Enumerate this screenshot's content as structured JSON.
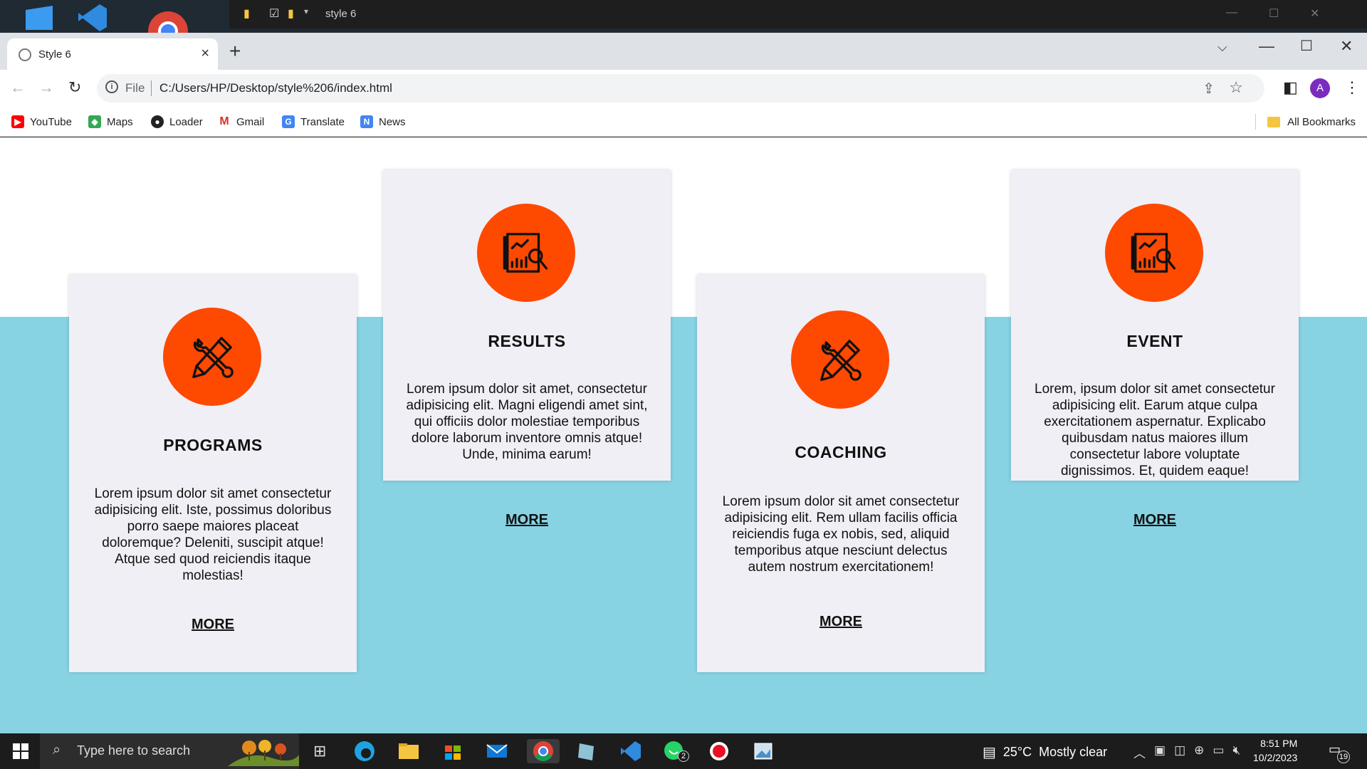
{
  "explorer_window": {
    "title": "style 6"
  },
  "browser": {
    "tab": {
      "title": "Style 6"
    },
    "address": {
      "scheme": "File",
      "url": "C:/Users/HP/Desktop/style%206/index.html"
    },
    "profile_initial": "A",
    "bookmarks": [
      {
        "label": "YouTube",
        "icon": "youtube-icon",
        "color": "#ff0000"
      },
      {
        "label": "Maps",
        "icon": "maps-icon",
        "color": "#34a853"
      },
      {
        "label": "Loader",
        "icon": "loader-icon",
        "color": "#222222"
      },
      {
        "label": "Gmail",
        "icon": "gmail-icon",
        "color": "#d93025"
      },
      {
        "label": "Translate",
        "icon": "translate-icon",
        "color": "#4285f4"
      },
      {
        "label": "News",
        "icon": "news-icon",
        "color": "#4285f4"
      }
    ],
    "all_bookmarks": "All Bookmarks"
  },
  "page": {
    "colors": {
      "accent": "#fe4901",
      "band": "#87d3e3",
      "card": "#f0eff5"
    },
    "cards": [
      {
        "title": "PROGRAMS",
        "icon": "tools-icon",
        "text": "Lorem ipsum dolor sit amet consectetur adipisicing elit. Iste, possimus doloribus porro saepe maiores placeat doloremque? Deleniti, suscipit atque! Atque sed quod reiciendis itaque molestias!",
        "link": "MORE"
      },
      {
        "title": "RESULTS",
        "icon": "report-analytics-icon",
        "text": "Lorem ipsum dolor sit amet, consectetur adipisicing elit. Magni eligendi amet sint, qui officiis dolor molestiae temporibus dolore laborum inventore omnis atque! Unde, minima earum!",
        "link": "MORE"
      },
      {
        "title": "COACHING",
        "icon": "tools-icon",
        "text": "Lorem ipsum dolor sit amet consectetur adipisicing elit. Rem ullam facilis officia reiciendis fuga ex nobis, sed, aliquid temporibus atque nesciunt delectus autem nostrum exercitationem!",
        "link": "MORE"
      },
      {
        "title": "EVENT",
        "icon": "report-analytics-icon",
        "text": "Lorem, ipsum dolor sit amet consectetur adipisicing elit. Earum atque culpa exercitationem aspernatur. Explicabo quibusdam natus maiores illum consectetur labore voluptate dignissimos. Et, quidem eaque!",
        "link": "MORE"
      }
    ]
  },
  "taskbar": {
    "search_placeholder": "Type here to search",
    "whatsapp_badge": "2",
    "weather": {
      "temp": "25°C",
      "condition": "Mostly clear"
    },
    "time": "8:51 PM",
    "date": "10/2/2023",
    "notifications": "19"
  }
}
